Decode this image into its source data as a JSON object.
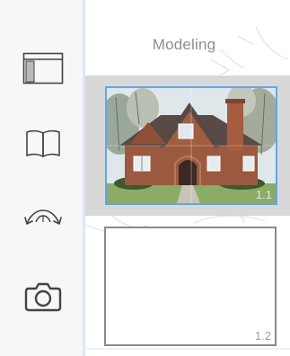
{
  "toolbar": {
    "items": [
      {
        "name": "sheets-tool",
        "icon": "sheet-panel-icon"
      },
      {
        "name": "notebook-tool",
        "icon": "open-book-icon"
      },
      {
        "name": "navigate-tool",
        "icon": "rotate-view-icon"
      },
      {
        "name": "camera-tool",
        "icon": "camera-icon"
      }
    ]
  },
  "panel": {
    "title": "Modeling",
    "sheets": [
      {
        "number": "1.1",
        "selected": true,
        "preview": "house-photo"
      },
      {
        "number": "1.2",
        "selected": false,
        "preview": "blank"
      }
    ]
  },
  "colors": {
    "selection_border": "#5ea8e6",
    "selected_row": "#d8d8d8",
    "toolbar_bg": "#f7f7f7",
    "icon_stroke": "#444444"
  }
}
